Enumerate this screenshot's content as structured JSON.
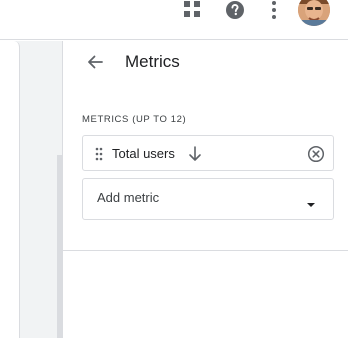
{
  "topbar": {
    "apps_icon": "apps-grid-icon",
    "help_icon": "help-circle-icon",
    "more_icon": "more-vert-icon"
  },
  "panel": {
    "title": "Metrics",
    "back_icon": "arrow-back-icon",
    "section_label": "METRICS (UP TO 12)",
    "metrics": [
      {
        "label": "Total users",
        "sort": "descending"
      }
    ],
    "add_metric_label": "Add metric"
  },
  "colors": {
    "icon_gray": "#5f6368",
    "border": "#dadce0",
    "text": "#202124",
    "canvas": "#f1f3f4"
  }
}
